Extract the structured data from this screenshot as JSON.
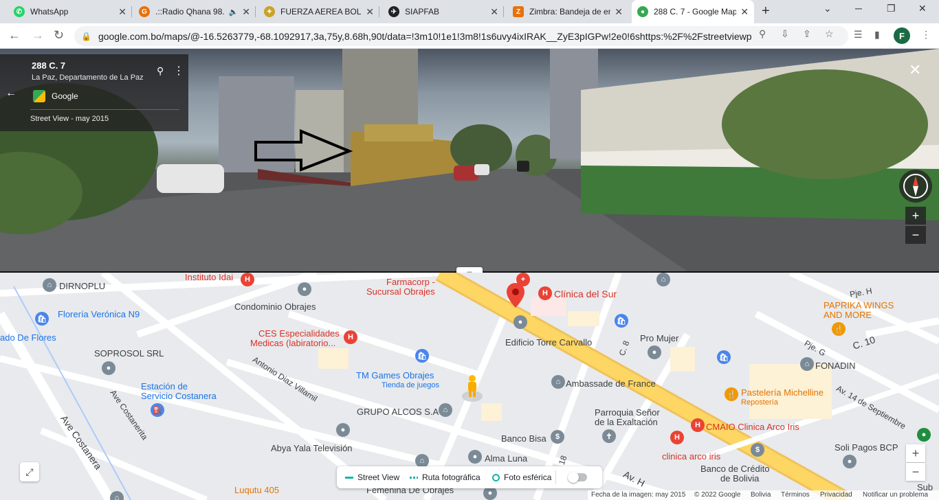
{
  "tabs": [
    {
      "title": "WhatsApp",
      "favicon": "whatsapp-icon",
      "color": "#25d366"
    },
    {
      "title": ".::Radio Qhana 98.",
      "favicon": "radio-icon",
      "color": "#e8710a"
    },
    {
      "title": "FUERZA AEREA BOLIV",
      "favicon": "emblem-icon",
      "color": "#c9a227"
    },
    {
      "title": "SIAPFAB",
      "favicon": "siapfab-icon",
      "color": "#202124"
    },
    {
      "title": "Zimbra: Bandeja de en",
      "favicon": "zimbra-icon",
      "color": "#e8710a"
    },
    {
      "title": "288 C. 7 - Google Map",
      "favicon": "maps-icon",
      "color": "#34a853"
    }
  ],
  "toolbar": {
    "url": "google.com.bo/maps/@-16.5263779,-68.1092917,3a,75y,8.68h,90t/data=!3m10!1e1!3m8!1s6uvy4ixIRAK__ZyE3pIGPw!2e0!6shttps:%2F%2Fstreetviewpixe...",
    "profile_initial": "F"
  },
  "streetview": {
    "address": "288 C. 7",
    "locality": "La Paz, Departamento de La Paz",
    "provider": "Google",
    "date": "Street View - may 2015"
  },
  "map": {
    "labels": {
      "dirnoplu": "DIRNOPLU",
      "instituto": "Instituto Idai",
      "farmacorp1": "Farmacorp -",
      "farmacorp2": "Sucursal Obrajes",
      "clinica_sur": "Clínica del Sur",
      "piej_h": "Pje. H",
      "floreria": "Florería Verónica N9",
      "mercado": "ado De Flores",
      "condominio": "Condominio Obrajes",
      "ces1": "CES Especialidades",
      "ces2": "Medicas (labiratorio...",
      "edificio": "Edificio Torre Carvallo",
      "c8": "C. 8",
      "promujer": "Pro Mujer",
      "paprika1": "PAPRIKA WINGS",
      "paprika2": "AND MORE",
      "piej_g": "Pje. G",
      "c10": "C. 10",
      "fonadin": "FONADIN",
      "soprosol": "SOPROSOL SRL",
      "antonio": "Antonio Diaz Villamil",
      "tmgames": "TM Games Obrajes",
      "tmgames_sub": "Tienda de juegos",
      "ambassade": "Ambassade de France",
      "pasteleria": "Pastelería Michelline",
      "reposteria": "Repostería",
      "estacion1": "Estación de",
      "estacion2": "Servicio Costanera",
      "ave_costanerita": "Ave Costanerita",
      "alcos": "GRUPO ALCOS S.A",
      "parroquia1": "Parroquia Señor",
      "parroquia2": "de la Exaltación",
      "av14": "Av. 14 de Septiembre",
      "ave_costanera": "Ave Costanera",
      "cmaio": "CMAIO Clinica Arco Iris",
      "banco_bisa": "Banco Bisa",
      "solipagos": "Soli Pagos BCP",
      "abya": "Abya Yala Televisión",
      "clinica_arco": "clinica arco iris",
      "alma": "Alma Luna",
      "banco_credito1": "Banco de Crédito",
      "banco_credito2": "de Bolivia",
      "luqutu": "Luqutu 405",
      "femenina": "Femenina De Obrajes",
      "av_h": "Av. H",
      "c18": "18",
      "sub": "Sub"
    },
    "layers": {
      "street_view": "Street View",
      "ruta": "Ruta fotográfica",
      "foto": "Foto esférica"
    },
    "footer": {
      "fecha": "Fecha de la imagen: may 2015",
      "copyright": "© 2022 Google",
      "country": "Bolivia",
      "terminos": "Términos",
      "privacidad": "Privacidad",
      "notificar": "Notificar un problema"
    }
  },
  "colors": {
    "accent": "#1a73e8",
    "road_major": "#fdd663",
    "map_bg": "#e8eaed",
    "street_view_layer": "#12b5a7"
  }
}
